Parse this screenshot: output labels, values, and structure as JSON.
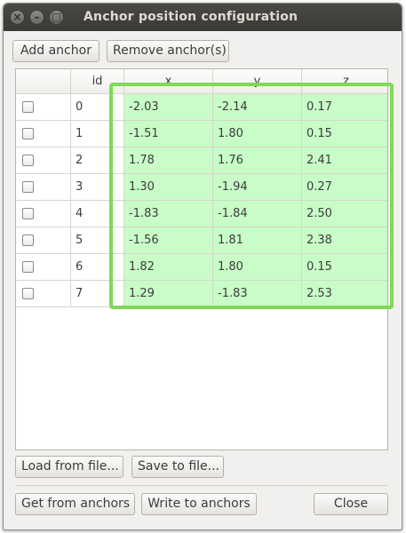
{
  "window": {
    "title": "Anchor position configuration"
  },
  "toolbar": {
    "add_label": "Add anchor",
    "remove_label": "Remove anchor(s)"
  },
  "table": {
    "columns": [
      "",
      "id",
      "x",
      "y",
      "z"
    ],
    "rows": [
      {
        "id": "0",
        "x": "-2.03",
        "y": "-2.14",
        "z": "0.17"
      },
      {
        "id": "1",
        "x": "-1.51",
        "y": "1.80",
        "z": "0.15"
      },
      {
        "id": "2",
        "x": "1.78",
        "y": "1.76",
        "z": "2.41"
      },
      {
        "id": "3",
        "x": "1.30",
        "y": "-1.94",
        "z": "0.27"
      },
      {
        "id": "4",
        "x": "-1.83",
        "y": "-1.84",
        "z": "2.50"
      },
      {
        "id": "5",
        "x": "-1.56",
        "y": "1.81",
        "z": "2.38"
      },
      {
        "id": "6",
        "x": "1.82",
        "y": "1.80",
        "z": "0.15"
      },
      {
        "id": "7",
        "x": "1.29",
        "y": "-1.83",
        "z": "2.53"
      }
    ]
  },
  "file_buttons": {
    "load_label": "Load from file...",
    "save_label": "Save to file..."
  },
  "footer": {
    "get_label": "Get from anchors",
    "write_label": "Write to anchors",
    "close_label": "Close"
  },
  "colors": {
    "cell_fill": "#c8fdc8",
    "highlight": "#7ed957"
  }
}
